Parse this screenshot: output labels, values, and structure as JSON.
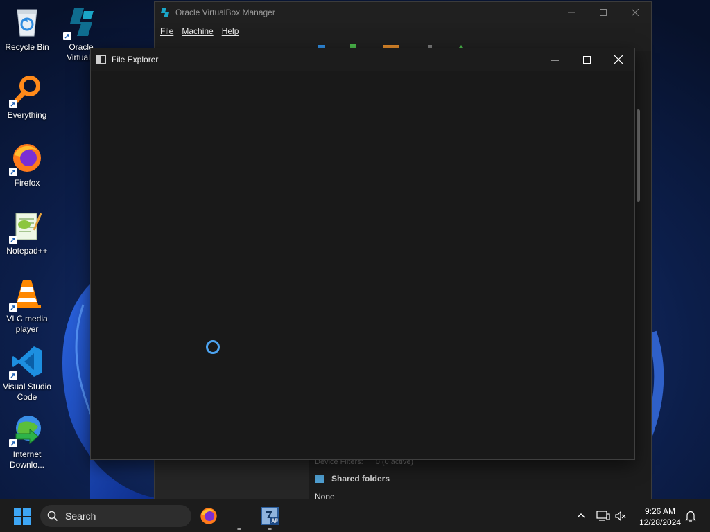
{
  "desktop": {
    "icons": [
      {
        "label": "Recycle Bin"
      },
      {
        "label": "Oracle VirtualB"
      },
      {
        "label": "Everything"
      },
      {
        "label": "Firefox"
      },
      {
        "label": "Notepad++"
      },
      {
        "label": "VLC media player"
      },
      {
        "label": "Visual Studio Code"
      },
      {
        "label": "Internet Downlo..."
      }
    ]
  },
  "vbox": {
    "title": "Oracle VirtualBox Manager",
    "menu": [
      "File",
      "Machine",
      "Help"
    ],
    "device_filters_label": "Device Filters:",
    "device_filters_value": "0 (0 active)",
    "shared_folders_label": "Shared folders",
    "shared_folders_value": "None"
  },
  "explorer": {
    "title": "File Explorer"
  },
  "taskbar": {
    "search_placeholder": "Search",
    "time": "9:26 AM",
    "date": "12/28/2024"
  },
  "colors": {
    "accent": "#4ca3f0",
    "taskbar": "#1c1c1c",
    "window_bg": "#191919"
  }
}
